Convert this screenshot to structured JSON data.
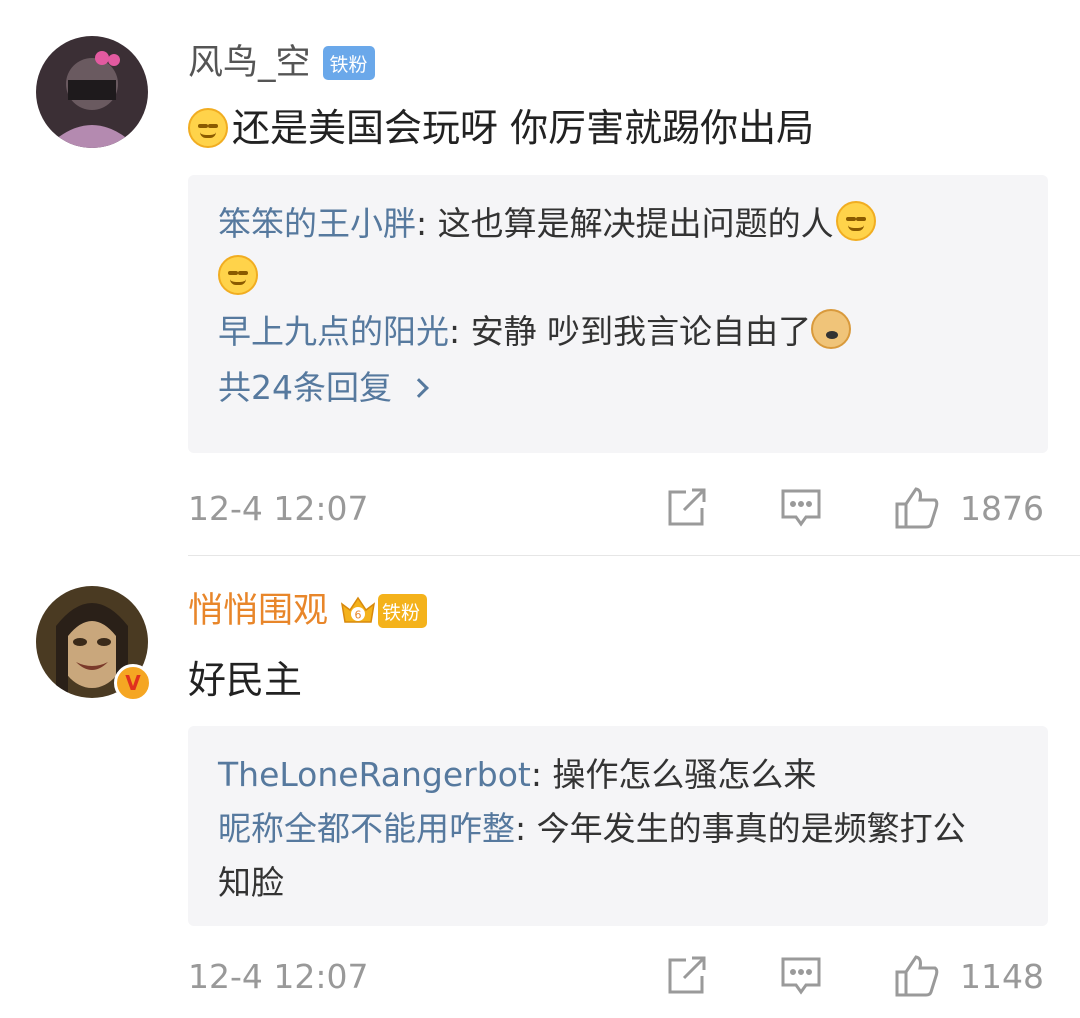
{
  "comments": [
    {
      "username": "风鸟_空",
      "badge": "铁粉",
      "text": "还是美国会玩呀 你厉害就踢你出局",
      "replies": [
        {
          "user": "笨笨的王小胖",
          "text": ": 这也算是解决提出问题的人"
        },
        {
          "user": "早上九点的阳光",
          "text": ": 安静  吵到我言论自由了"
        }
      ],
      "more_replies": "共24条回复",
      "time": "12-4 12:07",
      "likes": "1876"
    },
    {
      "username": "悄悄围观",
      "badge": "铁粉",
      "crown_level": "6",
      "verified_mark": "V",
      "text": "好民主",
      "replies": [
        {
          "user": "TheLoneRangerbot",
          "text": ": 操作怎么骚怎么来"
        },
        {
          "user": "昵称全都不能用咋整",
          "text": ": 今年发生的事真的是频繁打公知脸"
        }
      ],
      "time": "12-4 12:07",
      "likes": "1148"
    }
  ],
  "colors": {
    "reply_user": "#56799e",
    "orange_username": "#e8862a",
    "blue_badge": "#6aa8ea",
    "gold_badge": "#f4b21b"
  },
  "icons": [
    "share-icon",
    "comment-icon",
    "like-icon",
    "smile-emoji-icon",
    "doge-emoji-icon",
    "crown-icon",
    "verified-icon"
  ]
}
